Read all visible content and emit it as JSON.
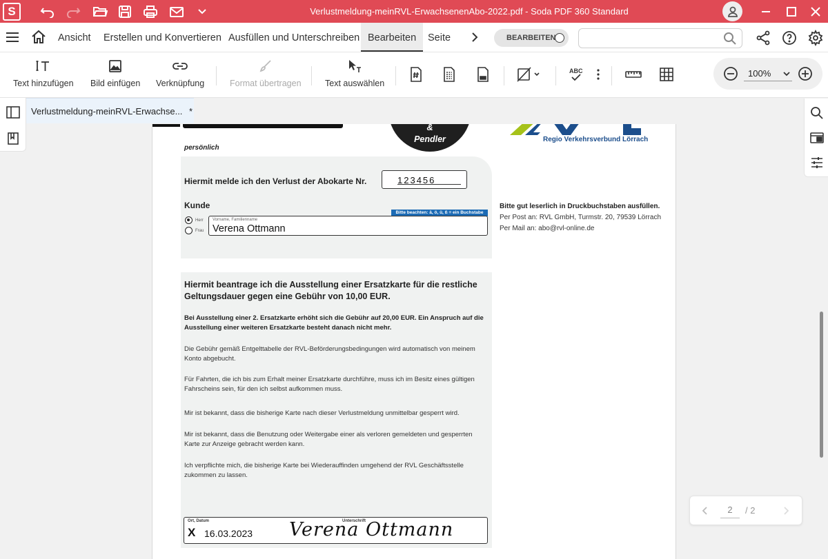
{
  "app": {
    "logo_letter": "S",
    "window_title": "Verlustmeldung-meinRVL-ErwachsenenAbo-2022.pdf   -   Soda PDF 360 Standard",
    "accent_color": "#e04a55"
  },
  "menu": {
    "items": [
      "Ansicht",
      "Erstellen und Konvertieren",
      "Ausfüllen und Unterschreiben",
      "Bearbeiten",
      "Seite"
    ],
    "active": "Bearbeiten",
    "toggle_label": "BEARBEITEN",
    "search_placeholder": ""
  },
  "toolbar": {
    "add_text": "Text hinzufügen",
    "insert_image": "Bild einfügen",
    "link": "Verknüpfung",
    "format_painter": "Format übertragen",
    "select_text": "Text auswählen",
    "zoom": "100%"
  },
  "tab": {
    "label": "Verlustmeldung-meinRVL-Erwachse...",
    "modified_mark": "*"
  },
  "document": {
    "persoenlich": "persönlich",
    "circle_amp": "&",
    "circle_text": "Pendler",
    "rvl_subtitle": "Regio Verkehrsverbund Lörrach",
    "verlust_text": "Hiermit melde ich den Verlust der  Abokarte Nr.",
    "abo_number": "123456",
    "kunde": "Kunde",
    "hint": "Bitte beachten: ä, ö, ü, ß = ein Buchstabe",
    "radio_herr": "Herr",
    "radio_frau": "Frau",
    "name_small_label": "Vorname, Familienname",
    "name_value": "Verena Ottmann",
    "info_bold": "Bitte gut leserlich in Druckbuchstaben ausfüllen.",
    "info_post": "Per Post an:  RVL GmbH, Turmstr. 20, 79539 Lörrach",
    "info_mail": "Per Mail an:  abo@rvl-online.de",
    "heading": "Hiermit beantrage ich die Ausstellung einer Ersatzkarte für die restliche Geltungsdauer gegen eine Gebühr von 10,00 EUR.",
    "bold_paragraph": "Bei Ausstellung einer 2. Ersatzkarte erhöht sich die Gebühr auf 20,00 EUR. Ein Anspruch auf die Ausstellung einer weiteren Ersatzkarte besteht danach nicht mehr.",
    "paragraphs": [
      "Die Gebühr gemäß Entgelttabelle der RVL-Beförderungsbedingungen wird automatisch von meinem Konto abgebucht.",
      "Für Fahrten, die ich bis zum Erhalt meiner Ersatzkarte durchführe, muss ich im Besitz eines gültigen Fahrscheins sein, für den ich selbst aufkommen muss.",
      "Mir ist bekannt, dass die bisherige Karte nach dieser Verlustmeldung unmittelbar gesperrt wird.",
      "Mir ist bekannt, dass die Benutzung oder Weitergabe einer als  verloren gemeldeten u‍nd gesperrten Karte zur Anzeige gebracht  werden kann.",
      "Ich verpflichte mich, die bisherige Karte bei Wiederauffinden umgehend der RVL Geschäftsstelle zukommen zu lassen."
    ],
    "sign_label_place": "Ort, Datum",
    "sign_label_signature": "Unterschrift",
    "sign_x": "X",
    "sign_date": "16.03.2023",
    "signature": "Verena  Ottmann"
  },
  "pager": {
    "current": "2",
    "total": "/ 2"
  }
}
